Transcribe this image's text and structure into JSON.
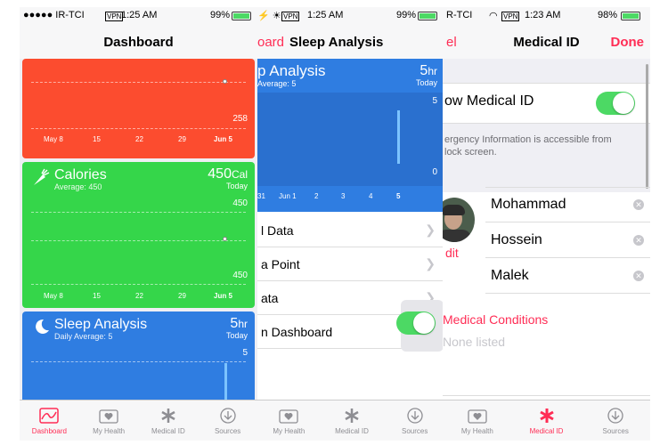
{
  "screen1": {
    "status": {
      "carrier": "●●●●● IR-TCI",
      "vpn": "VPN",
      "time": "1:25 AM",
      "battery": "99%"
    },
    "title": "Dashboard",
    "top_card": {
      "value_label": "258",
      "ticks": [
        "May 8",
        "15",
        "22",
        "29",
        "Jun 5"
      ],
      "color": "#fc4c2f"
    },
    "calories_card": {
      "title": "Calories",
      "subtitle": "Average: 450",
      "value": "450",
      "unit": "Cal",
      "period": "Today",
      "top_label": "450",
      "bottom_label": "450",
      "ticks": [
        "May 8",
        "15",
        "22",
        "29",
        "Jun 5"
      ],
      "color": "#35d64a"
    },
    "sleep_card": {
      "title": "Sleep Analysis",
      "subtitle": "Daily Average: 5",
      "value": "5",
      "unit": "hr",
      "period": "Today",
      "top_label": "5",
      "color": "#2f7de1"
    },
    "tabs": [
      "Dashboard",
      "My Health",
      "Medical ID",
      "Sources"
    ]
  },
  "screen2": {
    "status": {
      "vpn": "VPN",
      "time": "1:25 AM",
      "battery": "99%"
    },
    "back_label": "oard",
    "title": "Sleep Analysis",
    "card": {
      "title": "p Analysis",
      "subtitle": "Average: 5",
      "value": "5",
      "unit": "hr",
      "period": "Today",
      "top_label": "5",
      "bottom_label": "0",
      "ticks": [
        "31",
        "Jun 1",
        "2",
        "3",
        "4",
        "5"
      ]
    },
    "rows": [
      "l Data",
      "a Point",
      "ata",
      "n Dashboard"
    ],
    "tabs": [
      "My Health",
      "Medical ID",
      "Sources"
    ]
  },
  "screen3": {
    "status": {
      "carrier": "R-TCI",
      "vpn": "VPN",
      "time": "1:23 AM",
      "battery": "98%"
    },
    "cancel_label": "el",
    "title": "Medical ID",
    "done_label": "Done",
    "show_label": "ow Medical ID",
    "info_text": [
      "ergency Information is accessible from",
      "lock screen."
    ],
    "edit_label": "dit",
    "names": [
      "Mohammad",
      "Hossein",
      "Malek"
    ],
    "conditions_label": "Medical Conditions",
    "none_listed": "None listed",
    "tabs": [
      "My Health",
      "Medical ID",
      "Sources"
    ],
    "accent": "#ff2d55"
  }
}
